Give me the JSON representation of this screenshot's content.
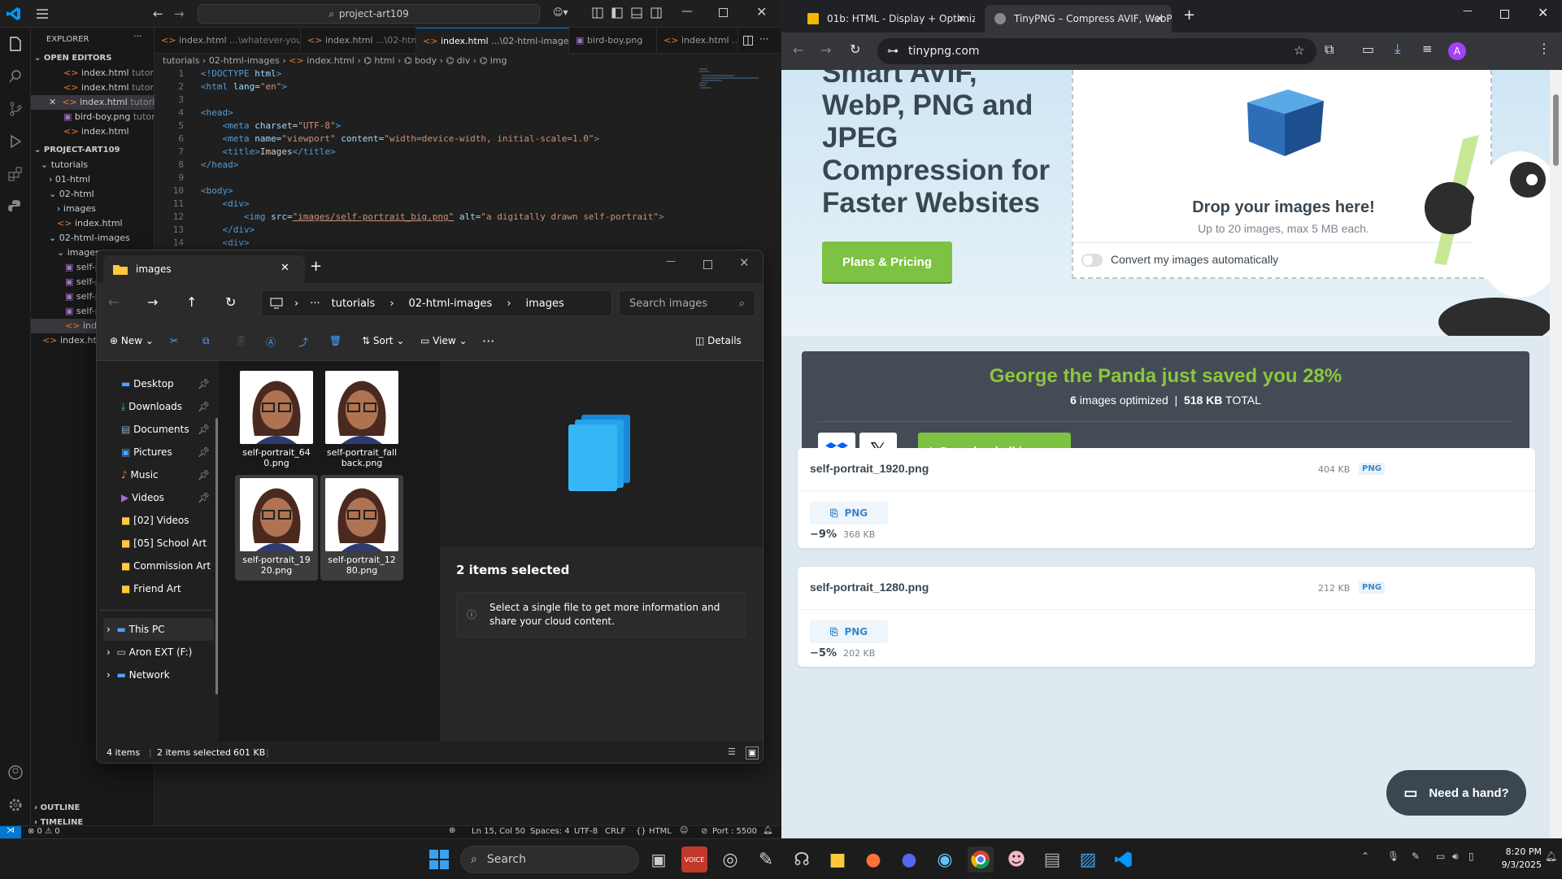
{
  "vscode": {
    "search": "project-art109",
    "explorer_title": "EXPLORER",
    "open_editors_label": "OPEN EDITORS",
    "open_editors": [
      {
        "name": "index.html",
        "hint": "tutorial..."
      },
      {
        "name": "index.html",
        "hint": "tutorial..."
      },
      {
        "name": "index.html",
        "hint": "tutorial..."
      },
      {
        "name": "bird-boy.png",
        "hint": "tutor..."
      },
      {
        "name": "index.html",
        "hint": ""
      }
    ],
    "project_label": "PROJECT-ART109",
    "tree": [
      "tutorials",
      "01-html",
      "02-html",
      "images",
      "index.html",
      "02-html-images",
      "images",
      "self-po",
      "self-po",
      "self-po",
      "self-po",
      "index.ht",
      "index.html"
    ],
    "outline": "OUTLINE",
    "timeline": "TIMELINE",
    "tabs": [
      {
        "name": "index.html",
        "hint": "...\\whatever-you-like"
      },
      {
        "name": "index.html",
        "hint": "...\\02-html"
      },
      {
        "name": "index.html",
        "hint": "...\\02-html-images"
      },
      {
        "name": "bird-boy.png",
        "hint": ""
      },
      {
        "name": "index.html",
        "hint": "...\\"
      }
    ],
    "breadcrumb": [
      "tutorials",
      "02-html-images",
      "index.html",
      "html",
      "body",
      "div",
      "img"
    ],
    "line_numbers": [
      "1",
      "2",
      "3",
      "4",
      "5",
      "6",
      "7",
      "8",
      "9",
      "10",
      "11",
      "12",
      "13",
      "14"
    ],
    "status": {
      "problems": "⊗ 0 ⚠ 0",
      "position": "Ln 15, Col 50",
      "spaces": "Spaces: 4",
      "encoding": "UTF-8",
      "eol": "CRLF",
      "language": "HTML",
      "port": "Port : 5500"
    }
  },
  "explorer": {
    "tab_title": "images",
    "path": [
      "tutorials",
      "02-html-images",
      "images"
    ],
    "search_placeholder": "Search images",
    "cmd": {
      "new": "New",
      "sort": "Sort",
      "view": "View",
      "details": "Details"
    },
    "nav": [
      {
        "label": "Desktop",
        "icon": "desktop-icon",
        "pinned": true
      },
      {
        "label": "Downloads",
        "icon": "download-icon",
        "pinned": true
      },
      {
        "label": "Documents",
        "icon": "documents-icon",
        "pinned": true
      },
      {
        "label": "Pictures",
        "icon": "pictures-icon",
        "pinned": true
      },
      {
        "label": "Music",
        "icon": "music-icon",
        "pinned": true
      },
      {
        "label": "Videos",
        "icon": "videos-icon",
        "pinned": true
      },
      {
        "label": "[02] Videos",
        "icon": "folder-icon",
        "pinned": false
      },
      {
        "label": "[05] School Art",
        "icon": "folder-icon",
        "pinned": false
      },
      {
        "label": "Commission Art",
        "icon": "folder-icon",
        "pinned": false
      },
      {
        "label": "Friend Art",
        "icon": "folder-icon",
        "pinned": false
      }
    ],
    "nav_bottom": [
      "This PC",
      "Aron EXT (F:)",
      "Network"
    ],
    "files": [
      {
        "name": "self-portrait_640.png",
        "selected": false
      },
      {
        "name": "self-portrait_fallback.png",
        "selected": false
      },
      {
        "name": "self-portrait_1920.png",
        "selected": true
      },
      {
        "name": "self-portrait_1280.png",
        "selected": true
      }
    ],
    "details_title": "2 items selected",
    "details_info": "Select a single file to get more information and share your cloud content.",
    "status": {
      "items": "4 items",
      "selected": "2 items selected",
      "size": "601 KB"
    }
  },
  "chrome": {
    "tabs": [
      {
        "title": "01b: HTML - Display + Optimiz",
        "active": false
      },
      {
        "title": "TinyPNG – Compress AVIF, WebP",
        "active": true
      }
    ],
    "url": "tinypng.com",
    "profile": "A",
    "page": {
      "headline": "Smart AVIF, WebP, PNG and JPEG Compression for Faster Websites",
      "plans": "Plans & Pricing",
      "drop_title": "Drop your images here!",
      "drop_sub": "Up to 20 images, max 5 MB each.",
      "convert": "Convert my images automatically",
      "saved_title": "George the Panda just saved you 28%",
      "saved_count": "6",
      "saved_count_text": "images optimized",
      "saved_total": "518 KB",
      "saved_total_text": "TOTAL",
      "download": "Download all images",
      "results": [
        {
          "name": "self-portrait_1920.png",
          "orig": "404 KB",
          "type": "PNG",
          "pct": "−9%",
          "new": "368 KB"
        },
        {
          "name": "self-portrait_1280.png",
          "orig": "212 KB",
          "type": "PNG",
          "pct": "−5%",
          "new": "202 KB"
        }
      ],
      "help": "Need a hand?"
    }
  },
  "taskbar": {
    "search": "Search",
    "time": "8:20 PM",
    "date": "9/3/2025"
  },
  "colors": {
    "vscode_bg": "#1f1f1f",
    "accent_blue": "#0078d4",
    "tinypng_green": "#7dc242",
    "saved_green": "#8cc63f",
    "panel_dark": "#434b54"
  }
}
